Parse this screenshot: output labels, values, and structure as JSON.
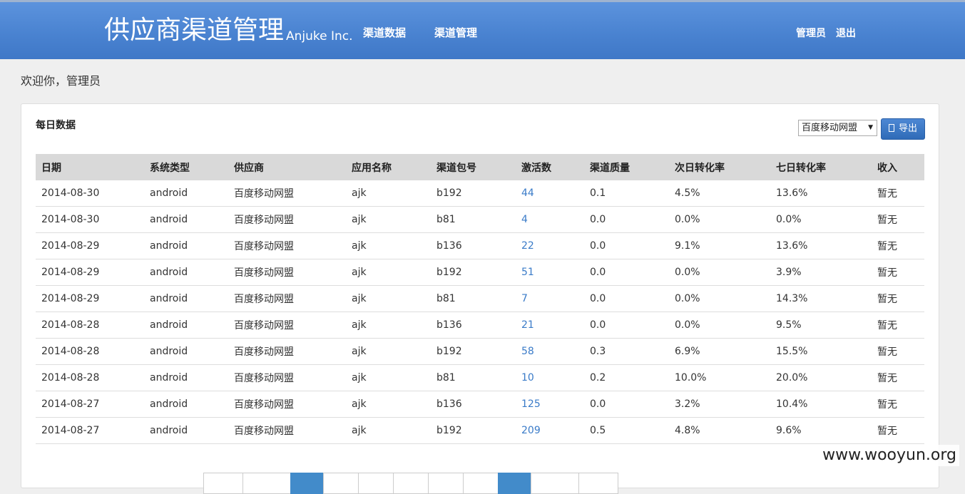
{
  "header": {
    "title": "供应商渠道管理",
    "company": "Anjuke Inc.",
    "nav": [
      "渠道数据",
      "渠道管理"
    ],
    "user": "管理员",
    "logout": "退出"
  },
  "welcome": "欢迎你，管理员",
  "panel": {
    "title": "每日数据",
    "select_value": "百度移动网盟",
    "export_label": "导出"
  },
  "table": {
    "headers": [
      "日期",
      "系统类型",
      "供应商",
      "应用名称",
      "渠道包号",
      "激活数",
      "渠道质量",
      "次日转化率",
      "七日转化率",
      "收入"
    ],
    "rows": [
      [
        "2014-08-30",
        "android",
        "百度移动网盟",
        "ajk",
        "b192",
        "44",
        "0.1",
        "4.5%",
        "13.6%",
        "暂无"
      ],
      [
        "2014-08-30",
        "android",
        "百度移动网盟",
        "ajk",
        "b81",
        "4",
        "0.0",
        "0.0%",
        "0.0%",
        "暂无"
      ],
      [
        "2014-08-29",
        "android",
        "百度移动网盟",
        "ajk",
        "b136",
        "22",
        "0.0",
        "9.1%",
        "13.6%",
        "暂无"
      ],
      [
        "2014-08-29",
        "android",
        "百度移动网盟",
        "ajk",
        "b192",
        "51",
        "0.0",
        "0.0%",
        "3.9%",
        "暂无"
      ],
      [
        "2014-08-29",
        "android",
        "百度移动网盟",
        "ajk",
        "b81",
        "7",
        "0.0",
        "0.0%",
        "14.3%",
        "暂无"
      ],
      [
        "2014-08-28",
        "android",
        "百度移动网盟",
        "ajk",
        "b136",
        "21",
        "0.0",
        "0.0%",
        "9.5%",
        "暂无"
      ],
      [
        "2014-08-28",
        "android",
        "百度移动网盟",
        "ajk",
        "b192",
        "58",
        "0.3",
        "6.9%",
        "15.5%",
        "暂无"
      ],
      [
        "2014-08-28",
        "android",
        "百度移动网盟",
        "ajk",
        "b81",
        "10",
        "0.2",
        "10.0%",
        "20.0%",
        "暂无"
      ],
      [
        "2014-08-27",
        "android",
        "百度移动网盟",
        "ajk",
        "b136",
        "125",
        "0.0",
        "3.2%",
        "10.4%",
        "暂无"
      ],
      [
        "2014-08-27",
        "android",
        "百度移动网盟",
        "ajk",
        "b192",
        "209",
        "0.5",
        "4.8%",
        "9.6%",
        "暂无"
      ]
    ]
  },
  "watermark": "www.wooyun.org",
  "colors": {
    "header": "#4a83d1",
    "link": "#3a7bc8",
    "table_header_bg": "#d9d9d9",
    "pager_active": "#428bca"
  }
}
